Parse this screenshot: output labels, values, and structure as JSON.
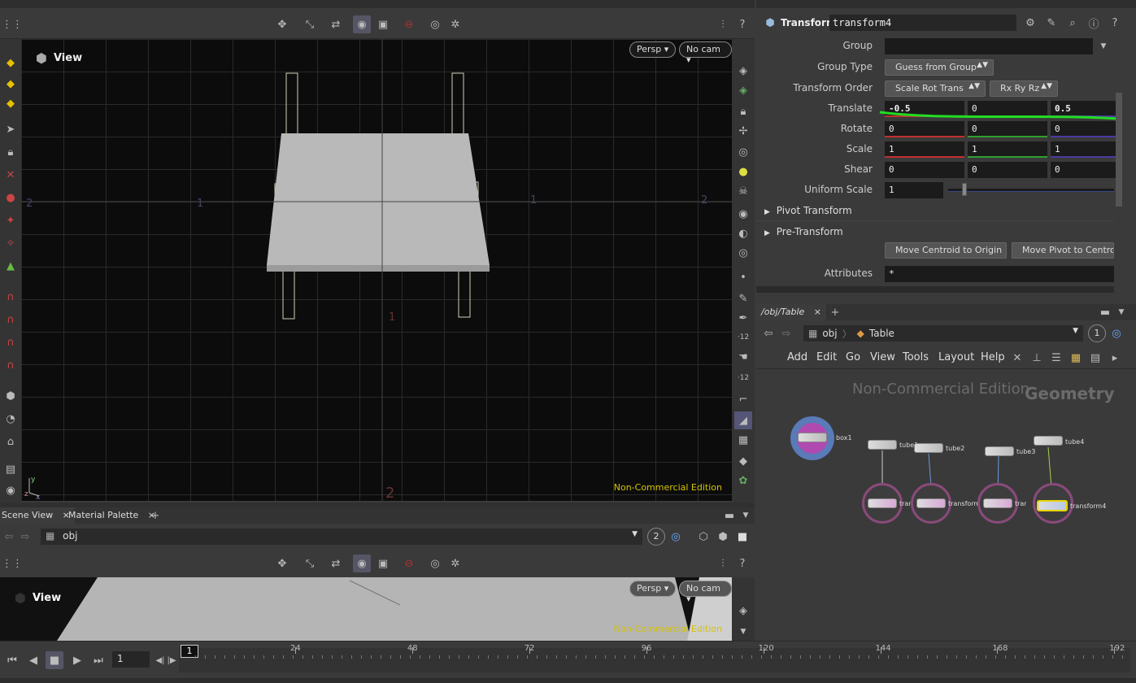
{
  "top_viewport": {
    "title": "View",
    "persp_label": "Persp ▾",
    "cam_label": "No cam ▾",
    "watermark": "Non-Commercial Edition",
    "grid_labels": [
      "2",
      "1",
      "1",
      "2",
      "1",
      "2"
    ]
  },
  "bottom_pane": {
    "tabs": [
      "Scene View",
      "Material Palette"
    ],
    "path": "obj",
    "viewport_title": "View",
    "persp_label": "Persp ▾",
    "cam_label": "No cam ▾",
    "watermark": "Non-Commercial Edition",
    "badge": "2"
  },
  "params": {
    "node_type": "Transform",
    "node_name": "transform4",
    "group_label": "Group",
    "group_value": "",
    "group_type_label": "Group Type",
    "group_type_value": "Guess from Group",
    "transform_order_label": "Transform Order",
    "transform_order_value": "Scale Rot Trans",
    "rot_order_value": "Rx Ry Rz",
    "translate_label": "Translate",
    "translate": [
      "-0.5",
      "0",
      "0.5"
    ],
    "rotate_label": "Rotate",
    "rotate": [
      "0",
      "0",
      "0"
    ],
    "scale_label": "Scale",
    "scale": [
      "1",
      "1",
      "1"
    ],
    "shear_label": "Shear",
    "shear": [
      "0",
      "0",
      "0"
    ],
    "uniform_scale_label": "Uniform Scale",
    "uniform_scale": "1",
    "uniform_scale_fraction": 0.1,
    "pivot_transform": "Pivot Transform",
    "pre_transform": "Pre-Transform",
    "move_centroid": "Move Centroid to Origin",
    "move_pivot": "Move Pivot to Centroid",
    "attributes_label": "Attributes",
    "attributes_value": "*"
  },
  "network": {
    "tab": "/obj/Table",
    "path_root": "obj",
    "path_node": "Table",
    "badge": "1",
    "menu": [
      "Add",
      "Edit",
      "Go",
      "View",
      "Tools",
      "Layout",
      "Help"
    ],
    "watermark": "Non-Commercial Edition",
    "context": "Geometry",
    "nodes": [
      "box1",
      "tube1",
      "tube2",
      "tube3",
      "tube4",
      "transform1",
      "transform2",
      "transform3",
      "transform4"
    ]
  },
  "timeline": {
    "frame": "1",
    "current_frame_marker": "1",
    "ticks": [
      "24",
      "48",
      "72",
      "96",
      "120",
      "144",
      "168",
      "192"
    ]
  },
  "colors": {
    "accent_yellow": "#e8c200",
    "translate_x": "#c03030",
    "translate_y": "#30a030",
    "translate_z": "#4a3aa0",
    "node_ring": "#8a4a7a",
    "selection": "#e8d400"
  }
}
